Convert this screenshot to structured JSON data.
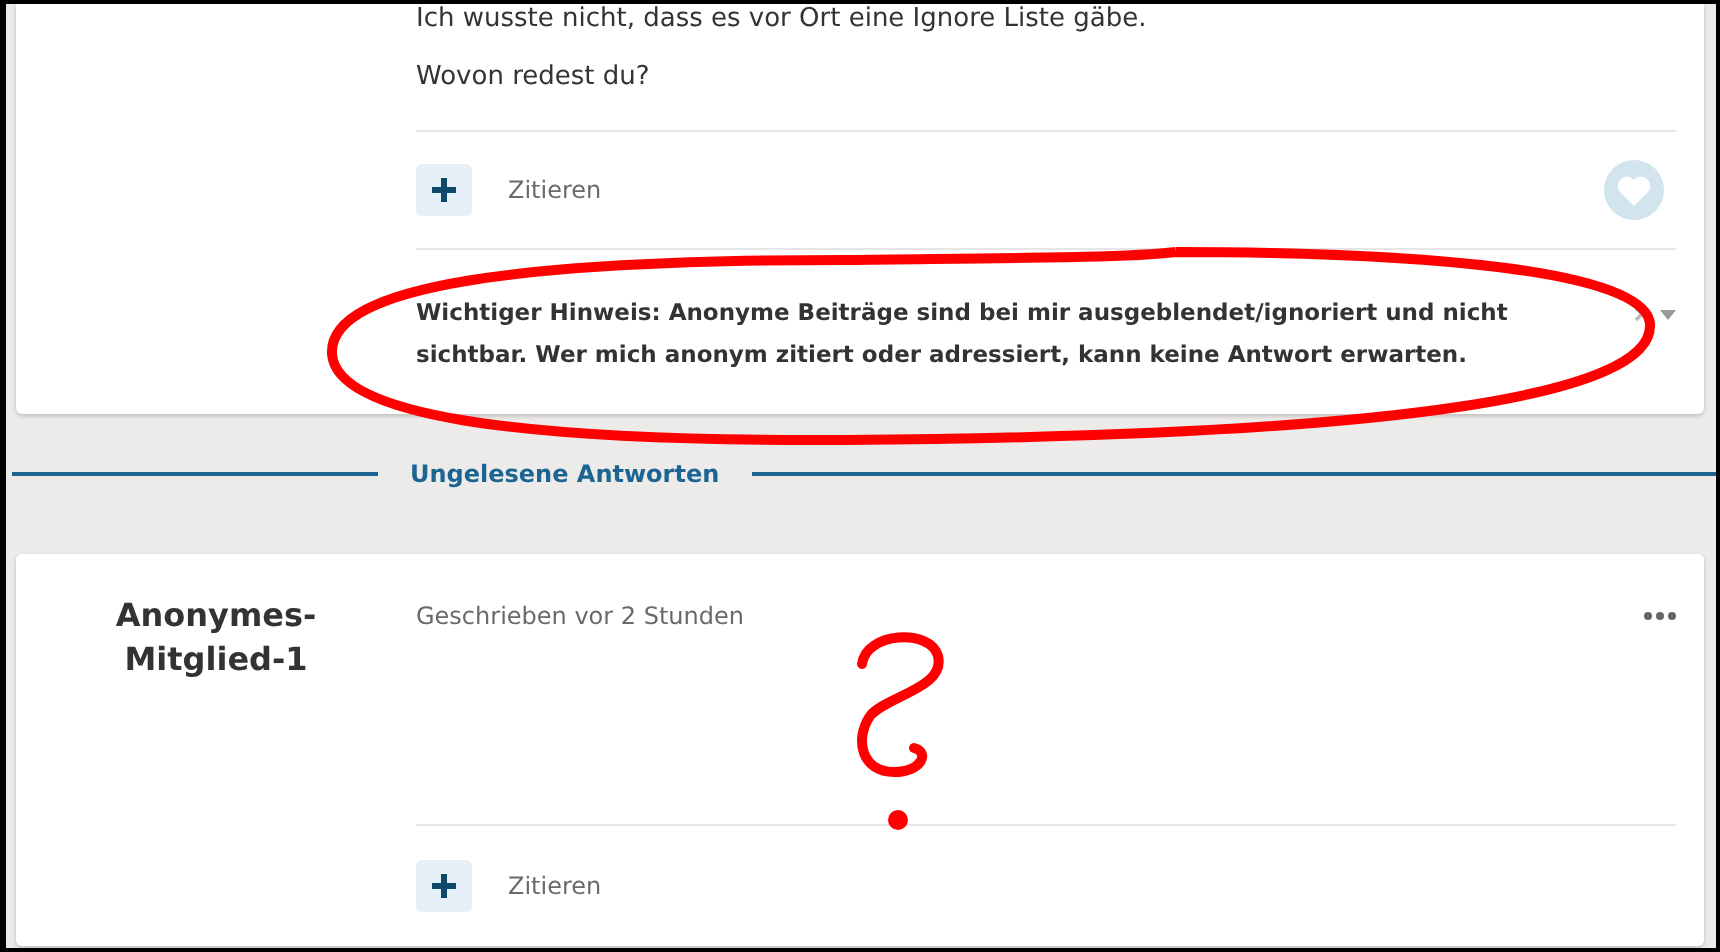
{
  "post": {
    "paragraphs": [
      "Ich wusste nicht, dass es vor Ort eine Ignore Liste gäbe.",
      "Wovon redest du?"
    ],
    "quote_button": {
      "label": "Zitieren"
    },
    "liked": false,
    "signature": "Wichtiger Hinweis: Anonyme Beiträge sind bei mir ausgeblendet/ignoriert und nicht sichtbar. Wer mich anonym zitiert oder adressiert, kann keine Antwort erwarten."
  },
  "section_divider": "Ungelesene Antworten",
  "reply": {
    "author": "Anonymes-Mitglied-1",
    "meta": "Geschrieben vor 2 Stunden",
    "quote_button": {
      "label": "Zitieren"
    }
  }
}
